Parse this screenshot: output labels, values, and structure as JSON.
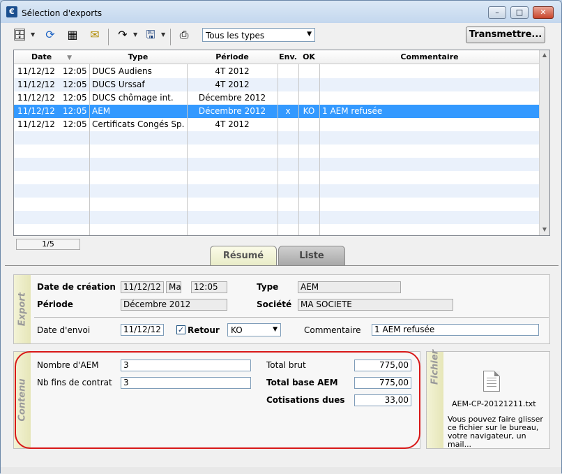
{
  "window": {
    "title": "Sélection d'exports",
    "icon_letter": "€"
  },
  "toolbar": {
    "type_filter": "Tous les types",
    "transmit_label": "Transmettre..."
  },
  "grid": {
    "headers": {
      "date": "Date",
      "type": "Type",
      "periode": "Période",
      "env": "Env.",
      "ok": "OK",
      "commentaire": "Commentaire"
    },
    "rows": [
      {
        "date": "11/12/12",
        "time": "12:05",
        "type": "DUCS Audiens",
        "periode": "4T 2012",
        "env": "",
        "ok": "",
        "commentaire": ""
      },
      {
        "date": "11/12/12",
        "time": "12:05",
        "type": "DUCS Urssaf",
        "periode": "4T 2012",
        "env": "",
        "ok": "",
        "commentaire": ""
      },
      {
        "date": "11/12/12",
        "time": "12:05",
        "type": "DUCS chômage int.",
        "periode": "Décembre 2012",
        "env": "",
        "ok": "",
        "commentaire": ""
      },
      {
        "date": "11/12/12",
        "time": "12:05",
        "type": "AEM",
        "periode": "Décembre 2012",
        "env": "x",
        "ok": "KO",
        "commentaire": "1 AEM refusée"
      },
      {
        "date": "11/12/12",
        "time": "12:05",
        "type": "Certificats Congés Sp.",
        "periode": "4T 2012",
        "env": "",
        "ok": "",
        "commentaire": ""
      }
    ],
    "selected_index": 3,
    "counter": "1/5"
  },
  "tabs": {
    "resume": "Résumé",
    "liste": "Liste"
  },
  "export": {
    "section_title": "Export",
    "date_creation_label": "Date de création",
    "date_creation": "11/12/12",
    "day": "Ma",
    "time": "12:05",
    "type_label": "Type",
    "type": "AEM",
    "periode_label": "Période",
    "periode": "Décembre 2012",
    "societe_label": "Société",
    "societe": "MA SOCIETE",
    "date_envoi_label": "Date d'envoi",
    "date_envoi": "11/12/12",
    "retour_label": "Retour",
    "retour_checked": "✓",
    "retour_value": "KO",
    "commentaire_label": "Commentaire",
    "commentaire": "1 AEM refusée"
  },
  "contenu": {
    "section_title": "Contenu",
    "nombre_aem_label": "Nombre d'AEM",
    "nombre_aem": "3",
    "nb_fins_label": "Nb fins de contrat",
    "nb_fins": "3",
    "total_brut_label": "Total brut",
    "total_brut": "775,00",
    "total_base_label": "Total base AEM",
    "total_base": "775,00",
    "cotisations_label": "Cotisations dues",
    "cotisations": "33,00"
  },
  "fichier": {
    "section_title": "Fichier",
    "filename": "AEM-CP-20121211.txt",
    "hint_lines": [
      "Vous pouvez faire glisser",
      "ce fichier sur le bureau,",
      "votre navigateur, un",
      "mail..."
    ]
  },
  "colors": {
    "selection": "#3399ff",
    "highlight_border": "#d81818"
  }
}
